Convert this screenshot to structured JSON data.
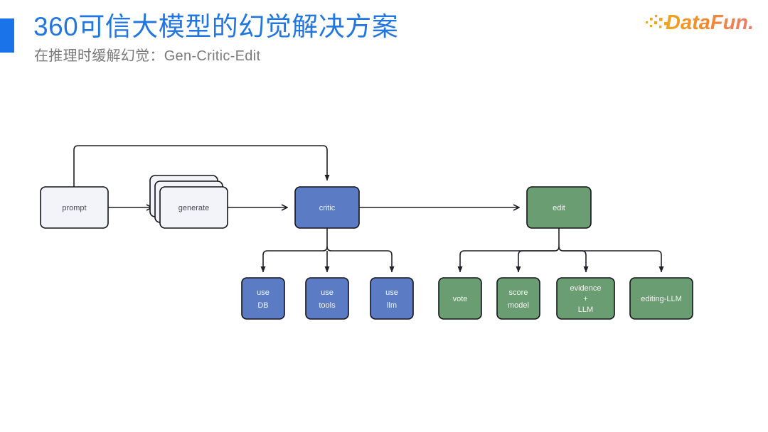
{
  "header": {
    "title": "360可信大模型的幻觉解决方案",
    "subtitle": "在推理时缓解幻觉：Gen-Critic-Edit",
    "accent_color": "#1a73e8",
    "title_color": "#2176e0",
    "subtitle_color": "#7a7a7a"
  },
  "logo": {
    "name": "DataFun",
    "text": "DataFun.",
    "color_start": "#f5a623",
    "color_end": "#ef7e6a"
  },
  "diagram": {
    "type": "flowchart",
    "colors": {
      "neutral_fill": "#f2f4fa",
      "blue_fill": "#5b7cc4",
      "green_fill": "#6a9d72",
      "stroke": "#13131b",
      "label_dark": "#4a4a55",
      "label_light": "#f2f5f2"
    },
    "pipeline": [
      {
        "id": "prompt",
        "label": "prompt",
        "style": "neutral",
        "stacked": false
      },
      {
        "id": "generate",
        "label": "generate",
        "style": "neutral",
        "stacked": true
      },
      {
        "id": "critic",
        "label": "critic",
        "style": "blue",
        "stacked": false
      },
      {
        "id": "edit",
        "label": "edit",
        "style": "green",
        "stacked": false
      }
    ],
    "critic_children": [
      {
        "id": "use-db",
        "lines": [
          "use",
          "DB"
        ],
        "style": "blue"
      },
      {
        "id": "use-tools",
        "lines": [
          "use",
          "tools"
        ],
        "style": "blue"
      },
      {
        "id": "use-llm",
        "lines": [
          "use",
          "llm"
        ],
        "style": "blue"
      }
    ],
    "edit_children": [
      {
        "id": "vote",
        "lines": [
          "vote"
        ],
        "style": "green"
      },
      {
        "id": "score-model",
        "lines": [
          "score",
          "model"
        ],
        "style": "green"
      },
      {
        "id": "evidence-llm",
        "lines": [
          "evidence",
          "+",
          "LLM"
        ],
        "style": "green"
      },
      {
        "id": "editing-llm",
        "lines": [
          "editing-LLM"
        ],
        "style": "green"
      }
    ],
    "edges": [
      {
        "from": "prompt",
        "to": "generate",
        "kind": "arrow"
      },
      {
        "from": "generate",
        "to": "critic",
        "kind": "arrow"
      },
      {
        "from": "critic",
        "to": "edit",
        "kind": "arrow"
      },
      {
        "from": "prompt",
        "to": "critic",
        "kind": "feedback-loop-top"
      },
      {
        "from": "critic",
        "to": "critic_children",
        "kind": "fan-out"
      },
      {
        "from": "edit",
        "to": "edit_children",
        "kind": "fan-out"
      }
    ]
  }
}
